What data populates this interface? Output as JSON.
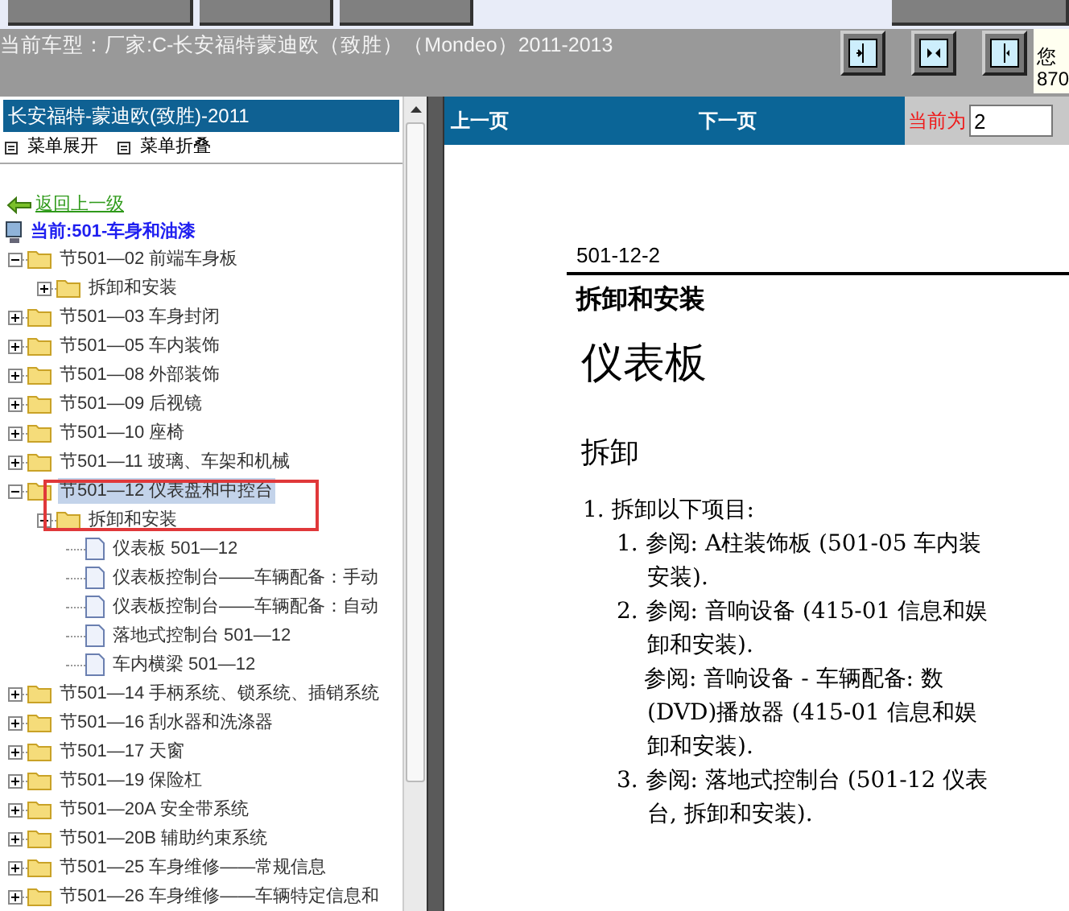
{
  "model_bar": {
    "label": "当前车型：厂家:C-长安福特蒙迪欧（致胜）（Mondeo）2011-2013",
    "notice_lines": [
      "您",
      "870"
    ]
  },
  "left_panel": {
    "title": "长安福特-蒙迪欧(致胜)-2011",
    "menu": [
      "菜单展开",
      "菜单折叠"
    ],
    "back_link": "返回上一级",
    "current": "当前:501-车身和油漆",
    "tree": [
      {
        "label": "节501—02 前端车身板",
        "kind": "folder",
        "expanded": true,
        "selected": false,
        "children": [
          {
            "label": "拆卸和安装",
            "kind": "folder",
            "expanded": false,
            "selected": false
          }
        ]
      },
      {
        "label": "节501—03 车身封闭",
        "kind": "folder",
        "expanded": false,
        "selected": false
      },
      {
        "label": "节501—05 车内装饰",
        "kind": "folder",
        "expanded": false,
        "selected": false
      },
      {
        "label": "节501—08 外部装饰",
        "kind": "folder",
        "expanded": false,
        "selected": false
      },
      {
        "label": "节501—09 后视镜",
        "kind": "folder",
        "expanded": false,
        "selected": false
      },
      {
        "label": "节501—10 座椅",
        "kind": "folder",
        "expanded": false,
        "selected": false
      },
      {
        "label": "节501—11 玻璃、车架和机械",
        "kind": "folder",
        "expanded": false,
        "selected": false
      },
      {
        "label": "节501—12 仪表盘和中控台",
        "kind": "folder",
        "expanded": true,
        "selected": true,
        "children": [
          {
            "label": "拆卸和安装",
            "kind": "folder",
            "expanded": true,
            "selected": false,
            "children": [
              {
                "label": "仪表板 501—12",
                "kind": "page",
                "selected": false
              },
              {
                "label": "仪表板控制台——车辆配备：手动",
                "kind": "page",
                "selected": false
              },
              {
                "label": "仪表板控制台——车辆配备：自动",
                "kind": "page",
                "selected": false
              },
              {
                "label": "落地式控制台 501—12",
                "kind": "page",
                "selected": false
              },
              {
                "label": "车内横梁 501—12",
                "kind": "page",
                "selected": false
              }
            ]
          }
        ]
      },
      {
        "label": "节501—14 手柄系统、锁系统、插销系统",
        "kind": "folder",
        "expanded": false,
        "selected": false
      },
      {
        "label": "节501—16 刮水器和洗涤器",
        "kind": "folder",
        "expanded": false,
        "selected": false
      },
      {
        "label": "节501—17 天窗",
        "kind": "folder",
        "expanded": false,
        "selected": false
      },
      {
        "label": "节501—19 保险杠",
        "kind": "folder",
        "expanded": false,
        "selected": false
      },
      {
        "label": "节501—20A 安全带系统",
        "kind": "folder",
        "expanded": false,
        "selected": false
      },
      {
        "label": "节501—20B 辅助约束系统",
        "kind": "folder",
        "expanded": false,
        "selected": false
      },
      {
        "label": "节501—25 车身维修——常规信息",
        "kind": "folder",
        "expanded": false,
        "selected": false
      },
      {
        "label": "节501—26 车身维修——车辆特定信息和",
        "kind": "folder",
        "expanded": false,
        "selected": false
      }
    ]
  },
  "pager": {
    "prev": "上一页",
    "next": "下一页",
    "current_label": "当前为",
    "current_value": "2"
  },
  "document": {
    "page_number": "501-12-2",
    "section": "拆卸和安装",
    "title": "仪表板",
    "heading": "拆卸",
    "lines": [
      {
        "kind": "step",
        "text": "1. 拆卸以下项目:"
      },
      {
        "kind": "sub",
        "text": "1. 参阅: A柱装饰板 (501-05 车内装"
      },
      {
        "kind": "cont",
        "text": "安装)."
      },
      {
        "kind": "sub",
        "text": "2. 参阅: 音响设备 (415-01 信息和娱"
      },
      {
        "kind": "cont",
        "text": "卸和安装)."
      },
      {
        "kind": "cont2",
        "text": "参阅: 音响设备 - 车辆配备:  数"
      },
      {
        "kind": "cont",
        "text": "(DVD)播放器 (415-01 信息和娱"
      },
      {
        "kind": "cont",
        "text": "卸和安装)."
      },
      {
        "kind": "sub",
        "text": "3. 参阅: 落地式控制台 (501-12 仪表"
      },
      {
        "kind": "cont",
        "text": "台, 拆卸和安装)."
      }
    ]
  }
}
